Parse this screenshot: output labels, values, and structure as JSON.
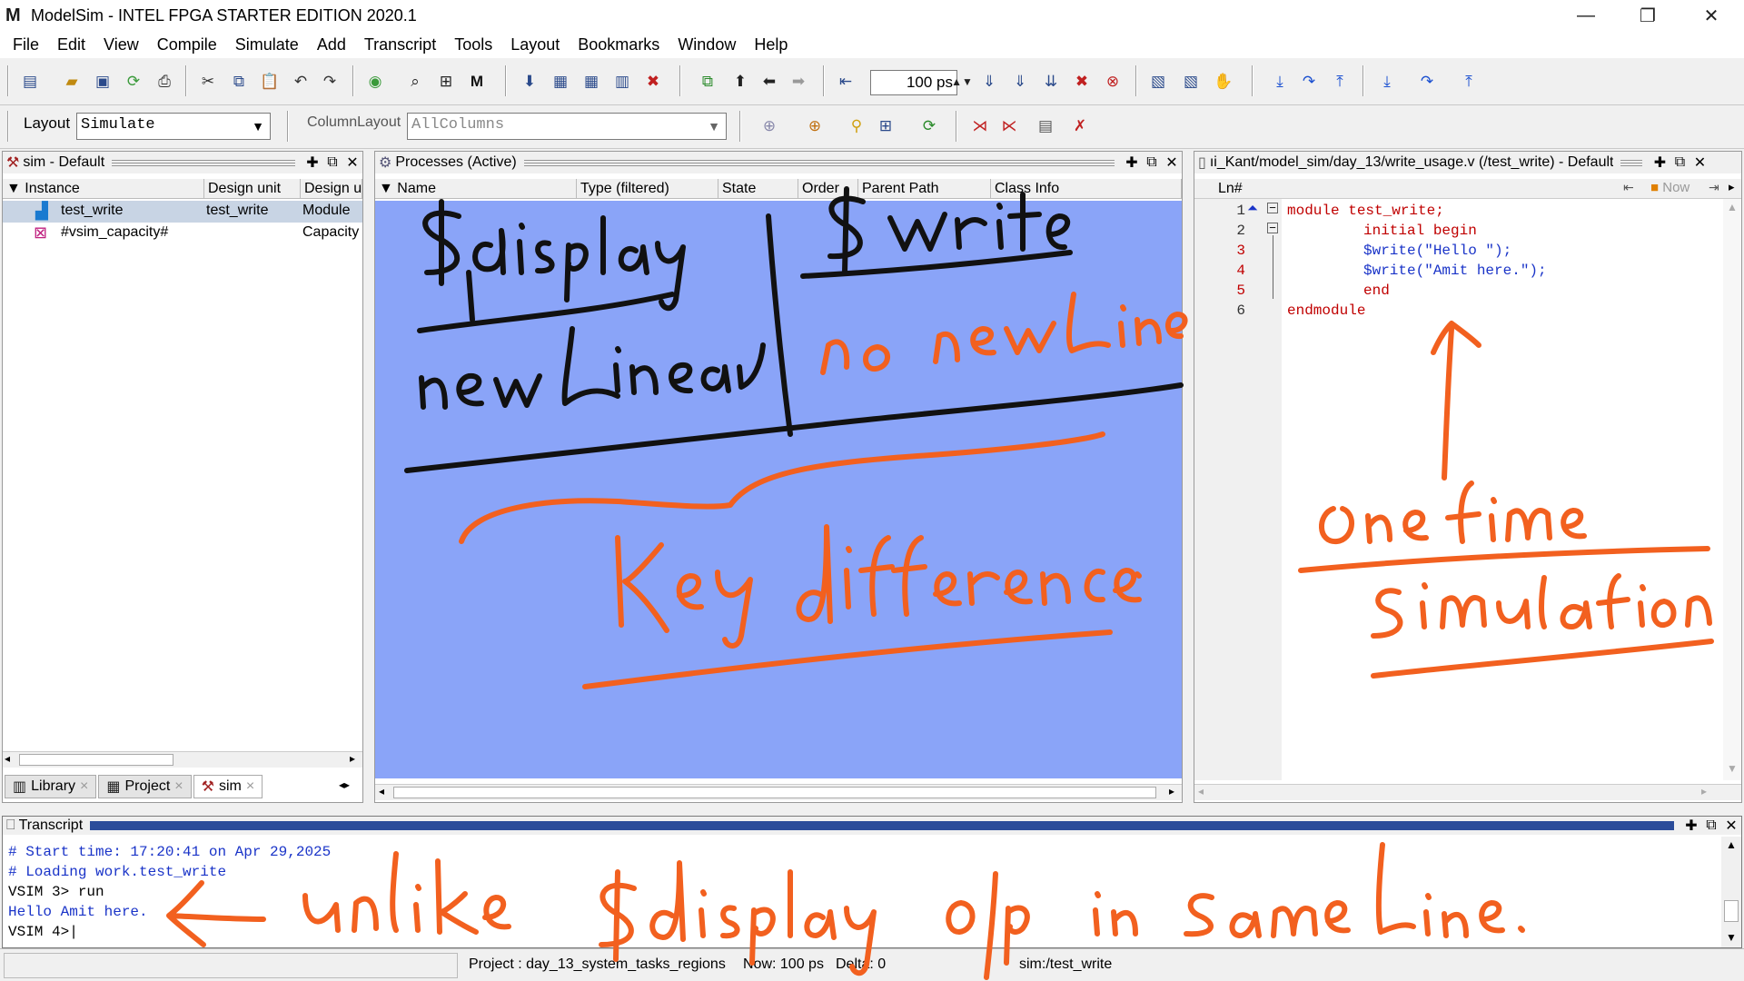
{
  "window": {
    "title": "ModelSim - INTEL FPGA STARTER EDITION 2020.1",
    "minimize": "—",
    "maximize": "❐",
    "close": "✕"
  },
  "menu": [
    "File",
    "Edit",
    "View",
    "Compile",
    "Simulate",
    "Add",
    "Transcript",
    "Tools",
    "Layout",
    "Bookmarks",
    "Window",
    "Help"
  ],
  "toolbar": {
    "runtime_value": "100 ps",
    "layout_label": "Layout",
    "layout_value": "Simulate",
    "column_layout_label": "ColumnLayout",
    "column_layout_value": "AllColumns"
  },
  "sim_pane": {
    "title": "sim - Default",
    "columns": [
      "Instance",
      "Design unit",
      "Design ur"
    ],
    "rows": [
      {
        "instance": "test_write",
        "design_unit": "test_write",
        "type": "Module"
      },
      {
        "instance": "#vsim_capacity#",
        "design_unit": "",
        "type": "Capacity"
      }
    ],
    "tabs": [
      {
        "label": "Library",
        "close": "×"
      },
      {
        "label": "Project",
        "close": "×"
      },
      {
        "label": "sim",
        "close": "×"
      }
    ]
  },
  "processes_pane": {
    "title": "Processes (Active)",
    "columns": [
      "Name",
      "Type (filtered)",
      "State",
      "Order",
      "Parent Path",
      "Class Info"
    ]
  },
  "source_pane": {
    "title": "ıi_Kant/model_sim/day_13/write_usage.v (/test_write) - Default",
    "ln_label": "Ln#",
    "now_label": "Now",
    "lines": [
      {
        "num": "1",
        "text": "module test_write;"
      },
      {
        "num": "2",
        "text": "initial begin"
      },
      {
        "num": "3",
        "text": "$write(\"Hello \");"
      },
      {
        "num": "4",
        "text": "$write(\"Amit here.\");"
      },
      {
        "num": "5",
        "text": "end"
      },
      {
        "num": "6",
        "text": "endmodule"
      }
    ]
  },
  "transcript": {
    "title": "Transcript",
    "lines": [
      "# Start time: 17:20:41 on Apr 29,2025",
      "# Loading work.test_write",
      "VSIM 3> run",
      "Hello Amit here.",
      "VSIM 4>"
    ]
  },
  "status": {
    "project": "Project : day_13_system_tasks_regions",
    "now": "Now: 100 ps",
    "delta": "Delta: 0",
    "context": "sim:/test_write"
  },
  "colors": {
    "process_bg": "#8aa4f8",
    "ink_black": "#111111",
    "ink_orange": "#f2601f",
    "code_red": "#c00000",
    "code_blue": "#1a34c8",
    "code_cyan": "#1aa0c8"
  }
}
